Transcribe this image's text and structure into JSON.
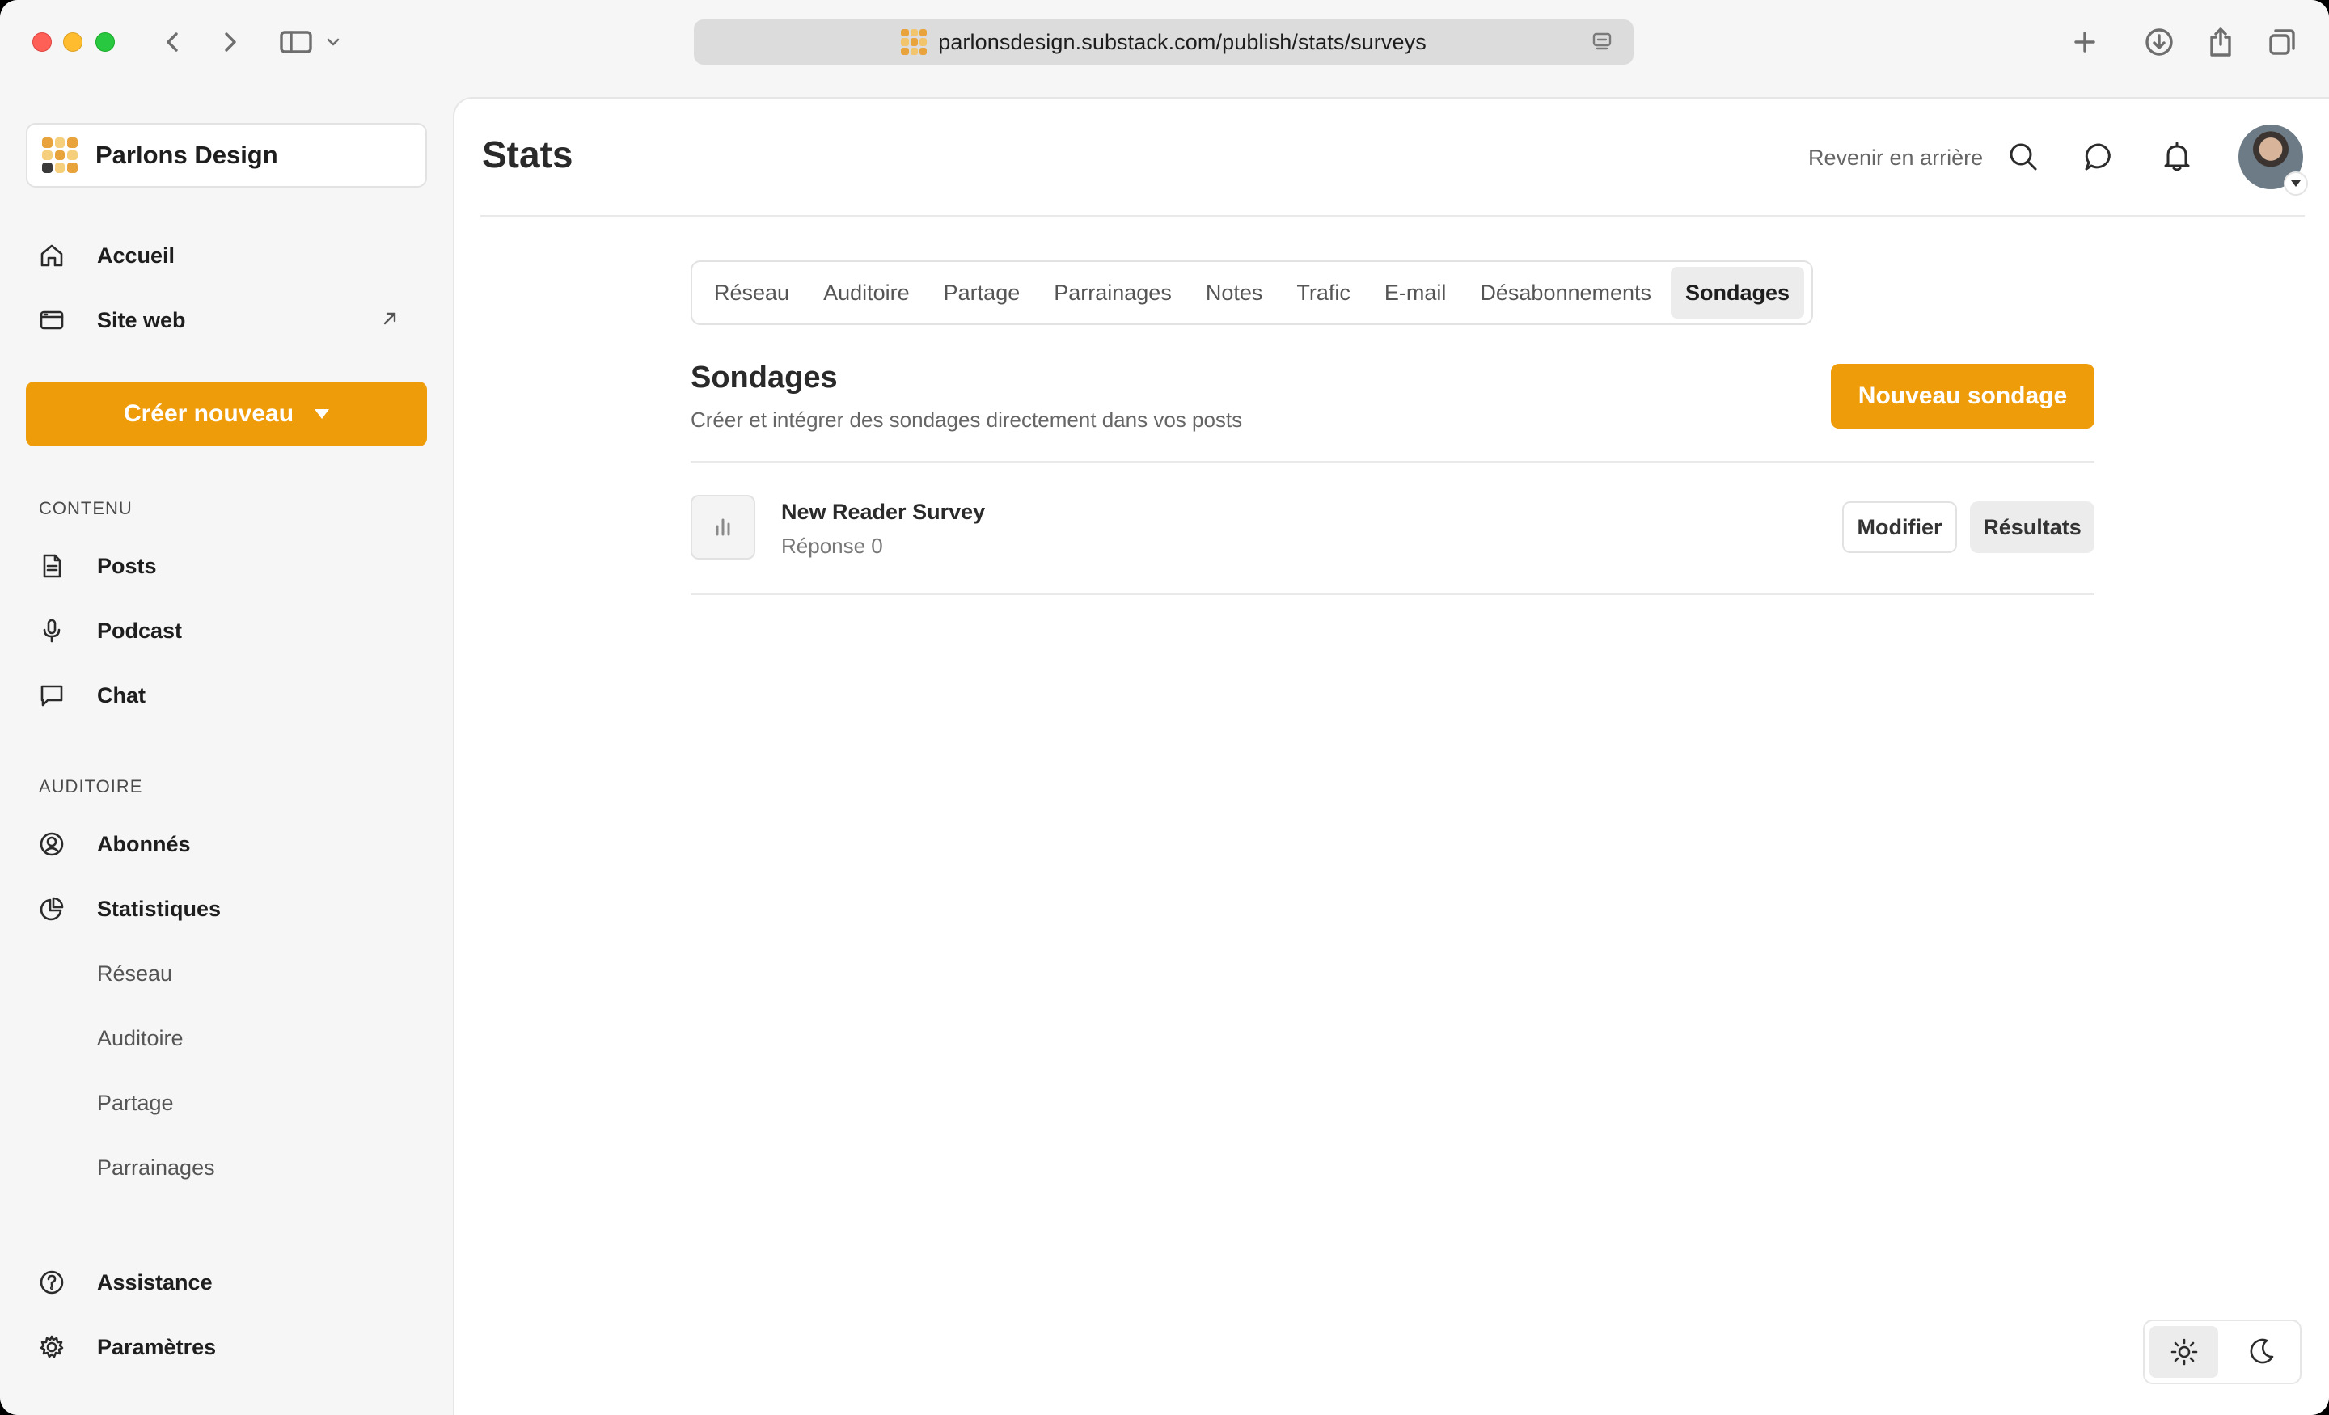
{
  "browser": {
    "url": "parlonsdesign.substack.com/publish/stats/surveys"
  },
  "sidebar": {
    "publication": "Parlons Design",
    "top_items": [
      {
        "label": "Accueil",
        "icon": "home-icon"
      },
      {
        "label": "Site web",
        "icon": "browser-window-icon"
      }
    ],
    "create_button": "Créer nouveau",
    "section_content": "CONTENU",
    "content_items": [
      {
        "label": "Posts",
        "icon": "document-icon"
      },
      {
        "label": "Podcast",
        "icon": "microphone-icon"
      },
      {
        "label": "Chat",
        "icon": "chat-bubble-icon"
      }
    ],
    "section_audience": "AUDITOIRE",
    "audience_items": [
      {
        "label": "Abonnés",
        "icon": "user-circle-icon"
      },
      {
        "label": "Statistiques",
        "icon": "pie-chart-icon"
      }
    ],
    "stats_sub_items": [
      "Réseau",
      "Auditoire",
      "Partage",
      "Parrainages"
    ],
    "bottom_items": [
      {
        "label": "Assistance",
        "icon": "help-circle-icon"
      },
      {
        "label": "Paramètres",
        "icon": "gear-icon"
      }
    ]
  },
  "header": {
    "title": "Stats",
    "back_link": "Revenir en arrière"
  },
  "tabs": [
    {
      "label": "Réseau"
    },
    {
      "label": "Auditoire"
    },
    {
      "label": "Partage"
    },
    {
      "label": "Parrainages"
    },
    {
      "label": "Notes"
    },
    {
      "label": "Trafic"
    },
    {
      "label": "E-mail"
    },
    {
      "label": "Désabonnements"
    },
    {
      "label": "Sondages",
      "active": true
    }
  ],
  "surveys": {
    "title": "Sondages",
    "subtitle": "Créer et intégrer des sondages directement dans vos posts",
    "new_button": "Nouveau sondage",
    "items": [
      {
        "name": "New Reader Survey",
        "responses": "Réponse 0",
        "edit_label": "Modifier",
        "results_label": "Résultats"
      }
    ]
  },
  "theme": {
    "current": "light"
  },
  "colors": {
    "accent": "#ef9c0a"
  }
}
